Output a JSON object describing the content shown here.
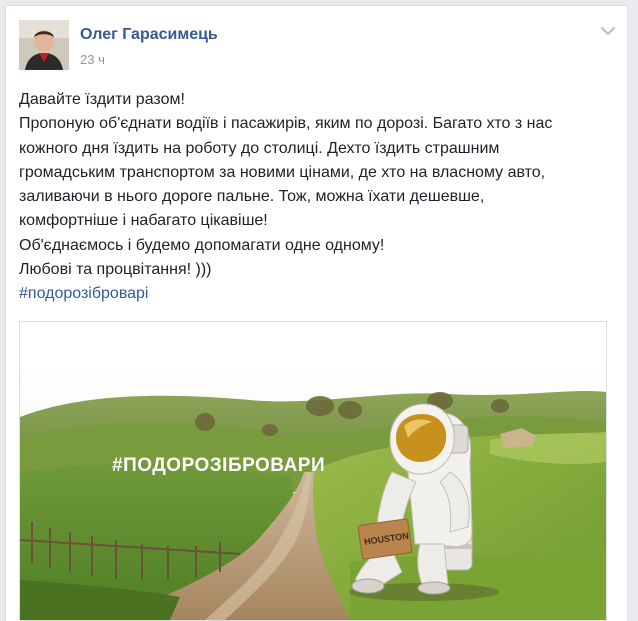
{
  "post": {
    "author": "Олег Гарасимець",
    "time": "23 ч",
    "text_lines": [
      "Давайте їздити разом!",
      "Пропоную об'єднати водіїв і пасажирів, яким по дорозі. Багато хто з нас",
      "кожного дня їздить на роботу до столиці. Дехто їздить страшним",
      "громадським транспортом за новими цінами, де хто на власному авто,",
      "заливаючи в нього дороге пальне. Тож, можна їхати дешевше,",
      "комфортніше і набагато цікавіше!",
      "Об'єднаємось і будемо допомагати одне одному!",
      "Любові та процвітання! )))"
    ],
    "hashtag": "#подорозіброварі",
    "image_overlay_text": "#ПОДОРОЗІБРОВАРИ",
    "sign_text": "HOUSTON"
  },
  "colors": {
    "link": "#365899",
    "text": "#1d2129",
    "meta": "#90949c"
  },
  "icons": {
    "options": "chevron-down-icon"
  }
}
